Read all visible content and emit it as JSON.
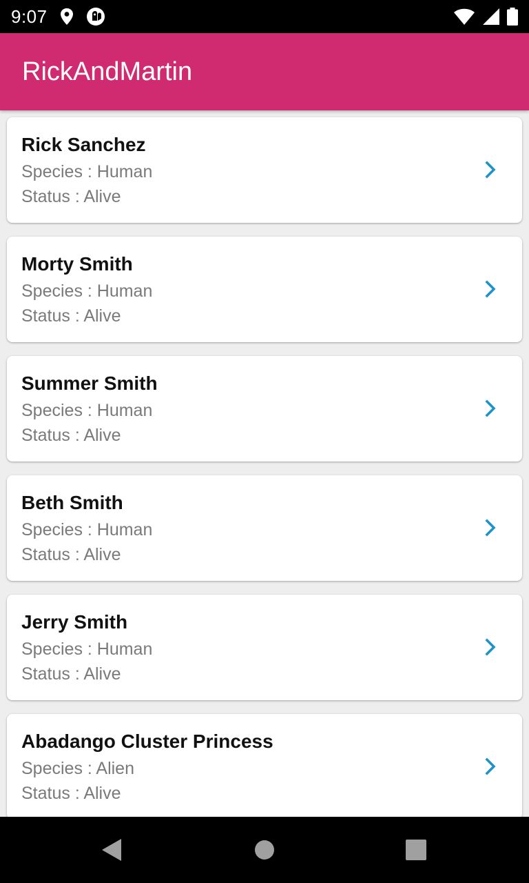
{
  "status_bar": {
    "time": "9:07",
    "left_icons": [
      "location-pin-icon",
      "notification-app-icon"
    ],
    "right_icons": [
      "wifi-icon",
      "cellular-signal-icon",
      "battery-icon"
    ]
  },
  "app_bar": {
    "title": "RickAndMartin",
    "color": "#d02b71"
  },
  "characters": [
    {
      "name": "Rick Sanchez",
      "species": "Species : Human",
      "status": "Status : Alive"
    },
    {
      "name": "Morty Smith",
      "species": "Species : Human",
      "status": "Status : Alive"
    },
    {
      "name": "Summer Smith",
      "species": "Species : Human",
      "status": "Status : Alive"
    },
    {
      "name": "Beth Smith",
      "species": "Species : Human",
      "status": "Status : Alive"
    },
    {
      "name": "Jerry Smith",
      "species": "Species : Human",
      "status": "Status : Alive"
    },
    {
      "name": "Abadango Cluster Princess",
      "species": "Species : Alien",
      "status": "Status : Alive"
    }
  ],
  "chevron_color": "#1e93c7",
  "nav_bar": {
    "buttons": [
      "back-icon",
      "home-icon",
      "recents-icon"
    ]
  }
}
